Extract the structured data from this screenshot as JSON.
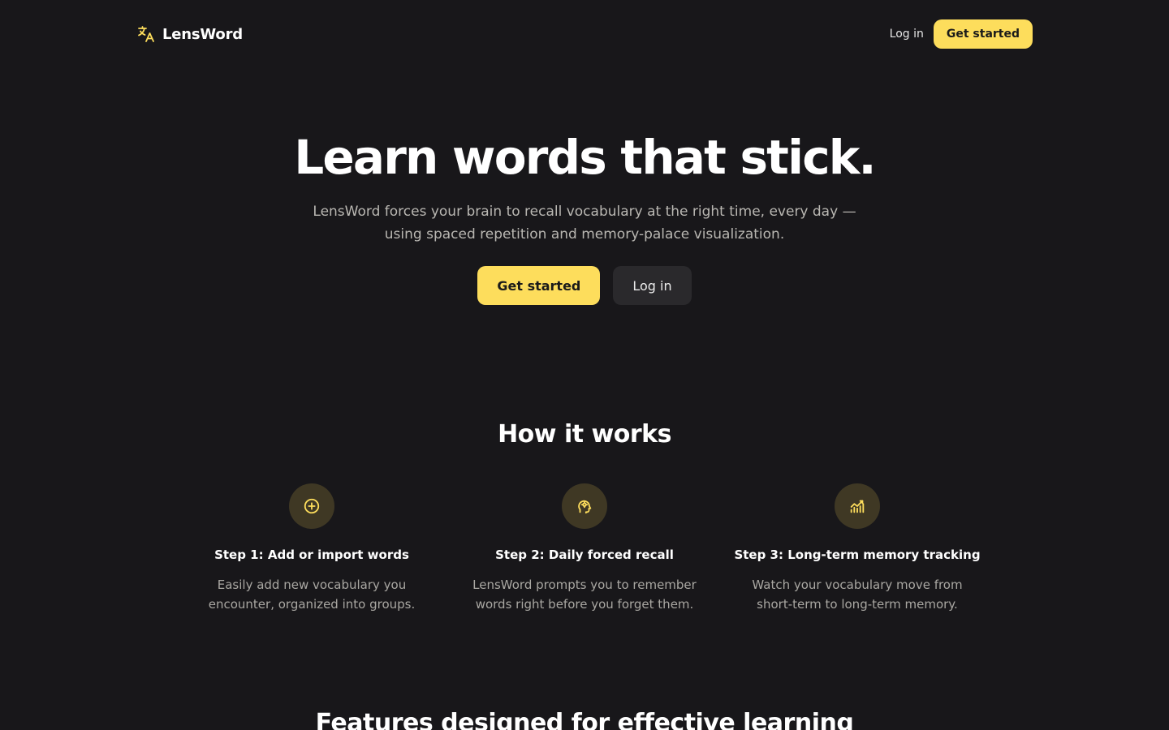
{
  "header": {
    "brand_name": "LensWord",
    "brand_icon": "translate-icon",
    "login_label": "Log in",
    "cta_label": "Get started"
  },
  "hero": {
    "title": "Learn words that stick.",
    "subtitle_line1": "LensWord forces your brain to recall vocabulary at the right time, every day —",
    "subtitle_line2": "using spaced repetition and memory-palace visualization.",
    "cta_label": "Get started",
    "login_label": "Log in"
  },
  "how_it_works": {
    "title": "How it works",
    "steps": [
      {
        "icon": "plus-circle-icon",
        "title": "Step 1: Add or import words",
        "desc_line1": "Easily add new vocabulary you",
        "desc_line2": "encounter, organized into groups."
      },
      {
        "icon": "brain-head-icon",
        "title": "Step 2: Daily forced recall",
        "desc_line1": "LensWord prompts you to remember",
        "desc_line2": "words right before you forget them."
      },
      {
        "icon": "chart-growth-icon",
        "title": "Step 3: Long-term memory tracking",
        "desc_line1": "Watch your vocabulary move from",
        "desc_line2": "short-term to long-term memory."
      }
    ]
  },
  "features": {
    "title": "Features designed for effective learning"
  },
  "colors": {
    "background": "#18171a",
    "accent": "#fddd5c",
    "icon_bg": "#3f3824",
    "secondary_button": "#2a292c",
    "muted_text": "#a9a7a2"
  }
}
